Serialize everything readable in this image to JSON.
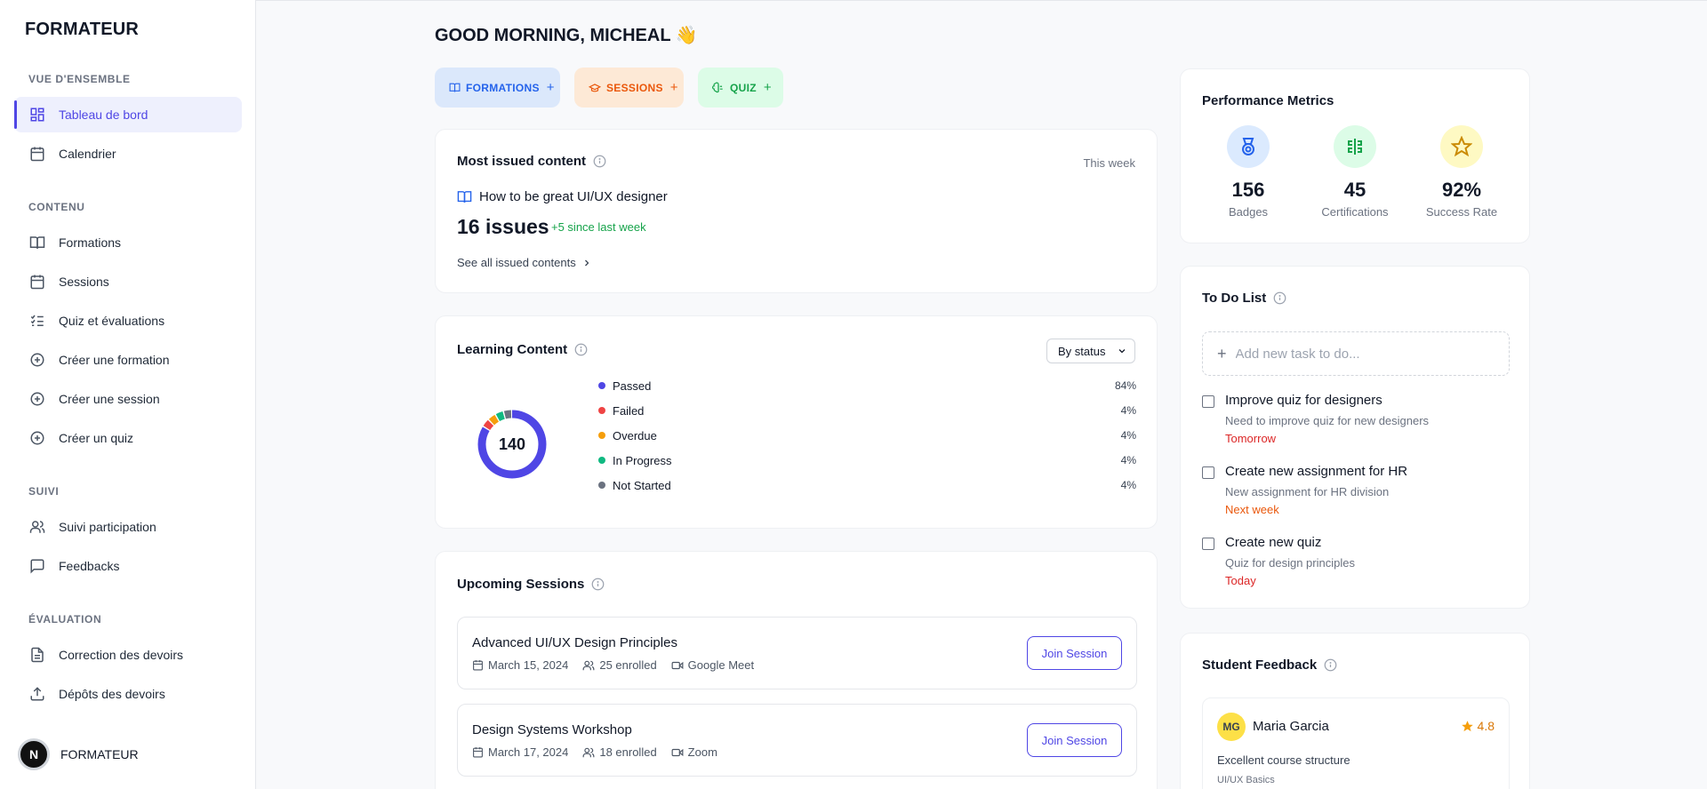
{
  "sidebar": {
    "brand": "FORMATEUR",
    "sections": {
      "overview": "VUE D'ENSEMBLE",
      "content": "CONTENU",
      "tracking": "SUIVI",
      "evaluation": "ÉVALUATION"
    },
    "items": {
      "dashboard": "Tableau de bord",
      "calendar": "Calendrier",
      "formations": "Formations",
      "sessions": "Sessions",
      "quizzes": "Quiz et évaluations",
      "create_formation": "Créer une formation",
      "create_session": "Créer une session",
      "create_quiz": "Créer un quiz",
      "participation": "Suivi participation",
      "feedbacks": "Feedbacks",
      "homework_correction": "Correction des devoirs",
      "homework_submissions": "Dépôts des devoirs"
    },
    "user": {
      "initial": "N",
      "name": "FORMATEUR"
    }
  },
  "main": {
    "greeting": "GOOD MORNING, MICHEAL 👋",
    "quick_actions": {
      "formations": "FORMATIONS",
      "sessions": "SESSIONS",
      "quiz": "QUIZ",
      "plus": "+"
    },
    "most_issued": {
      "title": "Most issued content",
      "period": "This week",
      "course": "How to be great UI/UX designer",
      "issues": "16 issues",
      "since": "+5 since last week",
      "link": "See all issued contents"
    },
    "learning_content": {
      "title": "Learning Content",
      "filter": "By status",
      "total": "140",
      "legend": [
        {
          "label": "Passed",
          "pct": "84%",
          "color": "#4f46e5"
        },
        {
          "label": "Failed",
          "pct": "4%",
          "color": "#ef4444"
        },
        {
          "label": "Overdue",
          "pct": "4%",
          "color": "#f59e0b"
        },
        {
          "label": "In Progress",
          "pct": "4%",
          "color": "#10b981"
        },
        {
          "label": "Not Started",
          "pct": "4%",
          "color": "#6b7280"
        }
      ]
    },
    "upcoming_sessions": {
      "title": "Upcoming Sessions",
      "join_label": "Join Session",
      "sessions": [
        {
          "title": "Advanced UI/UX Design Principles",
          "date": "March 15, 2024",
          "enrolled": "25 enrolled",
          "platform": "Google Meet"
        },
        {
          "title": "Design Systems Workshop",
          "date": "March 17, 2024",
          "enrolled": "18 enrolled",
          "platform": "Zoom"
        }
      ]
    }
  },
  "performance": {
    "title": "Performance Metrics",
    "metrics": [
      {
        "value": "156",
        "label": "Badges",
        "icon": "medal-icon",
        "bg": "#dbeafe",
        "fg": "#2563eb"
      },
      {
        "value": "45",
        "label": "Certifications",
        "icon": "certificate-icon",
        "bg": "#dcfce7",
        "fg": "#16a34a"
      },
      {
        "value": "92%",
        "label": "Success Rate",
        "icon": "star-icon",
        "bg": "#fef9c3",
        "fg": "#ca8a04"
      }
    ]
  },
  "todo": {
    "title": "To Do List",
    "placeholder": "Add new task to do...",
    "tasks": [
      {
        "title": "Improve quiz for designers",
        "desc": "Need to improve quiz for new designers",
        "due": "Tomorrow",
        "due_color": "#dc2626"
      },
      {
        "title": "Create new assignment for HR",
        "desc": "New assignment for HR division",
        "due": "Next week",
        "due_color": "#ea580c"
      },
      {
        "title": "Create new quiz",
        "desc": "Quiz for design principles",
        "due": "Today",
        "due_color": "#dc2626"
      }
    ]
  },
  "feedback": {
    "title": "Student Feedback",
    "items": [
      {
        "initials": "MG",
        "name": "Maria Garcia",
        "rating": "4.8",
        "text": "Excellent course structure",
        "course": "UI/UX Basics"
      }
    ]
  }
}
